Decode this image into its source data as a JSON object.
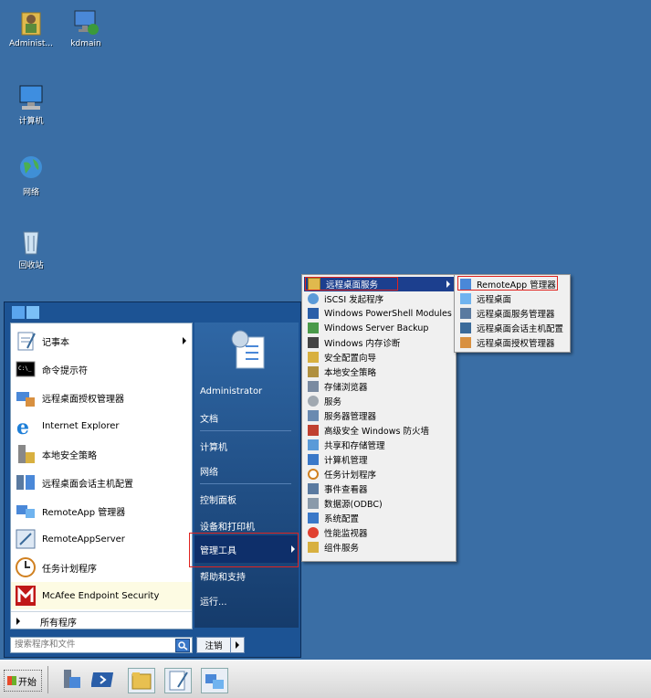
{
  "desktop": {
    "icons": [
      {
        "label": "Administ...",
        "icon": "user-folder-icon"
      },
      {
        "label": "kdmain",
        "icon": "network-computer-icon"
      },
      {
        "label": "计算机",
        "icon": "computer-icon"
      },
      {
        "label": "网络",
        "icon": "network-globe-icon"
      },
      {
        "label": "回收站",
        "icon": "recycle-bin-icon"
      }
    ]
  },
  "start_menu": {
    "pinned": [
      {
        "label": "记事本",
        "has_arrow": true
      },
      {
        "label": "命令提示符"
      },
      {
        "label": "远程桌面授权管理器"
      },
      {
        "label": "Internet Explorer"
      },
      {
        "label": "本地安全策略"
      },
      {
        "label": "远程桌面会话主机配置"
      },
      {
        "label": "RemoteApp 管理器"
      },
      {
        "label": "RemoteAppServer"
      },
      {
        "label": "任务计划程序"
      },
      {
        "label": "McAfee Endpoint Security"
      }
    ],
    "all_programs": "所有程序",
    "search_placeholder": "搜索程序和文件",
    "right": [
      "Administrator",
      "文档",
      "计算机",
      "网络",
      "控制面板",
      "设备和打印机",
      "管理工具",
      "帮助和支持",
      "运行..."
    ],
    "logoff_label": "注销"
  },
  "admin_tools_menu": {
    "items": [
      "远程桌面服务",
      "iSCSI 发起程序",
      "Windows PowerShell Modules",
      "Windows Server Backup",
      "Windows 内存诊断",
      "安全配置向导",
      "本地安全策略",
      "存储浏览器",
      "服务",
      "服务器管理器",
      "高级安全 Windows 防火墙",
      "共享和存储管理",
      "计算机管理",
      "任务计划程序",
      "事件查看器",
      "数据源(ODBC)",
      "系统配置",
      "性能监视器",
      "组件服务"
    ]
  },
  "rds_menu": {
    "items": [
      "RemoteApp 管理器",
      "远程桌面",
      "远程桌面服务管理器",
      "远程桌面会话主机配置",
      "远程桌面授权管理器"
    ]
  },
  "taskbar": {
    "start_label": "开始",
    "apps": [
      "server-manager-icon",
      "powershell-icon",
      "explorer-folder-icon",
      "notepad-icon",
      "network-icon"
    ]
  },
  "colors": {
    "desktop": "#3a6ea5",
    "highlight": "#1c3f8e",
    "redbox": "#e0231f"
  }
}
